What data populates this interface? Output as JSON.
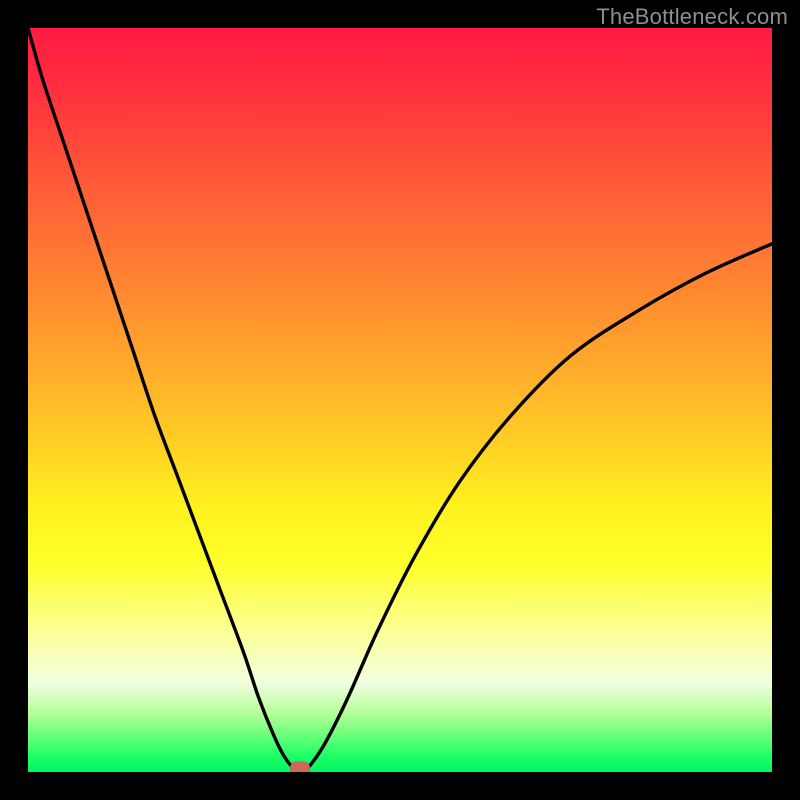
{
  "watermark": "TheBottleneck.com",
  "chart_data": {
    "type": "line",
    "title": "",
    "xlabel": "",
    "ylabel": "",
    "xlim": [
      0,
      100
    ],
    "ylim": [
      0,
      100
    ],
    "grid": false,
    "legend": false,
    "series": [
      {
        "name": "bottleneck-curve",
        "x": [
          0,
          2,
          5,
          8,
          11,
          14,
          17,
          20,
          23,
          26,
          29,
          31,
          33,
          34.5,
          36,
          37,
          38,
          40,
          43,
          47,
          52,
          58,
          65,
          73,
          82,
          91,
          100
        ],
        "y": [
          100,
          93,
          84,
          75,
          66,
          57,
          48,
          40,
          32,
          24,
          16,
          10,
          5,
          2,
          0.3,
          0.3,
          1,
          4,
          10,
          19,
          29,
          39,
          48,
          56,
          62,
          67,
          71
        ]
      }
    ],
    "marker": {
      "x": 36.6,
      "y": 0.5
    },
    "background": "rainbow-red-to-green-vertical"
  }
}
